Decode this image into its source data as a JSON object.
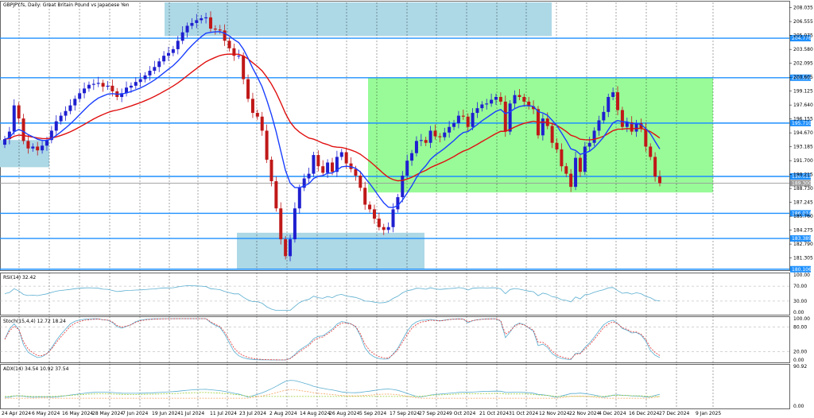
{
  "chart_data": {
    "type": "candlestick",
    "title": "GBPJPY.fs, Daily: Great Britain Pound vs Japanese Yen",
    "colors": {
      "bull": "#1f1fd0",
      "bear": "#c01818",
      "ma_fast": "#1a3fff",
      "ma_slow": "#e01010",
      "zone_blue": "#add8e6",
      "zone_green": "#98fb98",
      "hline": "#1e90ff",
      "osc_main": "#5aaed0",
      "osc_signal": "#e03030",
      "adx_plus": "#9acd32",
      "adx_minus": "#f4a460"
    },
    "ylim": [
      180.0,
      208.6
    ],
    "y_ticks": [
      "208.035",
      "206.555",
      "205.075",
      "203.580",
      "202.095",
      "200.605",
      "199.125",
      "197.640",
      "196.155",
      "194.670",
      "193.185",
      "191.700",
      "190.215",
      "188.730",
      "187.245",
      "185.760",
      "184.275",
      "182.790",
      "181.305",
      "179.815"
    ],
    "x_labels": [
      "24 Apr 2024",
      "6 May 2024",
      "16 May 2024",
      "28 May 2024",
      "7 Jun 2024",
      "19 Jun 2024",
      "1 Jul 2024",
      "11 Jul 2024",
      "23 Jul 2024",
      "2 Aug 2024",
      "14 Aug 2024",
      "26 Aug 2024",
      "5 Sep 2024",
      "17 Sep 2024",
      "27 Sep 2024",
      "9 Oct 2024",
      "21 Oct 2024",
      "31 Oct 2024",
      "12 Nov 2024",
      "22 Nov 2024",
      "4 Dec 2024",
      "16 Dec 2024",
      "27 Dec 2024",
      "9 Jan 2025"
    ],
    "closes": [
      194.0,
      194.8,
      197.6,
      196.2,
      193.8,
      193.0,
      193.2,
      192.8,
      193.3,
      193.9,
      194.9,
      195.9,
      196.5,
      197.0,
      197.6,
      198.3,
      198.9,
      199.4,
      199.8,
      199.9,
      200.0,
      199.6,
      199.7,
      199.1,
      198.5,
      198.9,
      199.5,
      199.7,
      200.1,
      200.4,
      200.8,
      201.3,
      201.7,
      202.3,
      202.9,
      203.2,
      203.6,
      204.5,
      205.4,
      206.1,
      206.4,
      206.7,
      206.9,
      207.0,
      205.8,
      205.7,
      205.6,
      204.5,
      203.7,
      202.9,
      202.9,
      200.4,
      198.3,
      196.8,
      196.4,
      194.9,
      191.8,
      189.5,
      186.6,
      183.3,
      181.5,
      183.3,
      186.6,
      188.8,
      189.8,
      190.3,
      192.3,
      191.1,
      190.4,
      191.5,
      190.5,
      192.1,
      192.6,
      191.4,
      190.8,
      190.1,
      188.8,
      187.0,
      186.5,
      185.5,
      184.6,
      184.3,
      184.6,
      186.5,
      187.8,
      190.1,
      191.7,
      192.5,
      193.8,
      193.9,
      193.6,
      194.9,
      194.3,
      194.2,
      194.7,
      195.3,
      195.7,
      196.5,
      196.4,
      195.3,
      196.8,
      197.3,
      197.7,
      197.8,
      198.2,
      198.5,
      198.0,
      194.8,
      197.8,
      198.7,
      198.5,
      198.0,
      197.5,
      197.2,
      194.4,
      196.2,
      195.4,
      193.6,
      192.9,
      191.1,
      190.3,
      188.9,
      192.0,
      190.5,
      193.2,
      193.6,
      194.9,
      196.0,
      196.9,
      198.5,
      199.0,
      197.1,
      195.3,
      195.8,
      194.8,
      195.7,
      195.1,
      193.2,
      192.1,
      190.0,
      189.3
    ],
    "price_levels": [
      {
        "value": "204.776"
      },
      {
        "value": "200.556"
      },
      {
        "value": "195.710"
      },
      {
        "value": "190.015"
      },
      {
        "value": "189.300"
      },
      {
        "value": "186.074"
      },
      {
        "value": "183.389"
      },
      {
        "value": "180.106"
      }
    ],
    "indicators": [
      {
        "label": "RSI(14) 32.42",
        "ticks": [
          "100.00",
          "70.00",
          "30.00",
          "0.00"
        ]
      },
      {
        "label": "Stoch(15,4,4) 12.72 18.24",
        "ticks": [
          "100.00",
          "80.00",
          "20.00",
          "0.00"
        ]
      },
      {
        "label": "ADX(14) 34.54 10.92 37.54",
        "ticks": [
          "90.92",
          "0.00"
        ]
      }
    ]
  }
}
